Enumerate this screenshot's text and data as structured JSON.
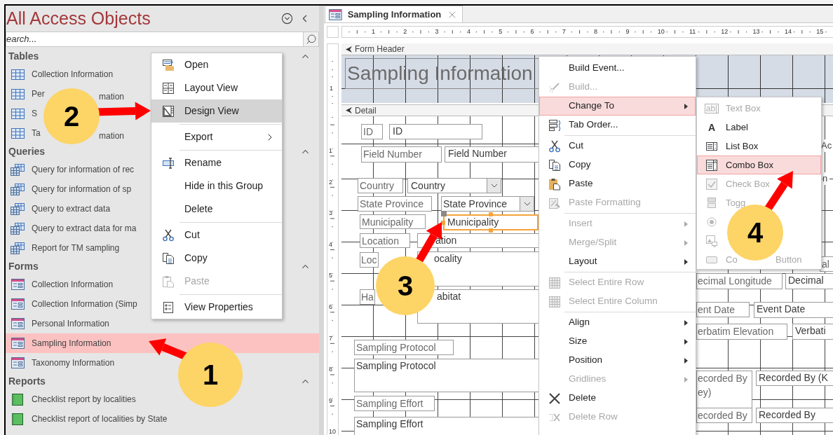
{
  "nav": {
    "title": "All Access Objects",
    "search": {
      "placeholder": "earch..."
    },
    "sections": [
      {
        "title": "Tables",
        "kind": "table",
        "items": [
          {
            "label": "Collection Information",
            "selected": false
          },
          {
            "label": "Per",
            "label_end": "mation",
            "selected": false
          },
          {
            "label": "S",
            "selected": false
          },
          {
            "label": "Ta",
            "label_end": "mation",
            "selected": false
          }
        ]
      },
      {
        "title": "Queries",
        "kind": "query",
        "items": [
          {
            "label": "Query for information of rec",
            "selected": false
          },
          {
            "label": "Query for information of sp",
            "selected": false
          },
          {
            "label": "Query to extract data",
            "selected": false
          },
          {
            "label": "Query to extract data for ma",
            "selected": false
          },
          {
            "label": "Report for TM sampling",
            "selected": false
          }
        ]
      },
      {
        "title": "Forms",
        "kind": "form",
        "items": [
          {
            "label": "Collection Information",
            "selected": false
          },
          {
            "label": "Collection Information (Simp",
            "selected": false
          },
          {
            "label": "Personal Information",
            "selected": false
          },
          {
            "label": "Sampling Information",
            "selected": true
          },
          {
            "label": "Taxonomy Information",
            "selected": false
          }
        ]
      },
      {
        "title": "Reports",
        "kind": "report",
        "items": [
          {
            "label": "Checklist report by localities",
            "selected": false
          },
          {
            "label": "Checklist report of localities by State",
            "selected": false
          }
        ]
      }
    ]
  },
  "nav_menu": {
    "items": [
      {
        "kind": "item",
        "label": "Open",
        "selected": false,
        "disabled": false,
        "submenu": false
      },
      {
        "kind": "item",
        "label": "Layout View",
        "selected": false,
        "disabled": false,
        "submenu": false
      },
      {
        "kind": "item",
        "label": "Design View",
        "selected": true,
        "disabled": false,
        "submenu": false
      },
      {
        "kind": "separator"
      },
      {
        "kind": "item",
        "label": "Export",
        "selected": false,
        "disabled": false,
        "submenu": true
      },
      {
        "kind": "separator"
      },
      {
        "kind": "item",
        "label": "Rename",
        "selected": false,
        "disabled": false,
        "submenu": false
      },
      {
        "kind": "item",
        "label": "Hide in this Group",
        "selected": false,
        "disabled": false,
        "submenu": false
      },
      {
        "kind": "item",
        "label": "Delete",
        "selected": false,
        "disabled": false,
        "submenu": false
      },
      {
        "kind": "separator"
      },
      {
        "kind": "item",
        "label": "Cut",
        "selected": false,
        "disabled": false,
        "submenu": false
      },
      {
        "kind": "item",
        "label": "Copy",
        "selected": false,
        "disabled": false,
        "submenu": false
      },
      {
        "kind": "item",
        "label": "Paste",
        "selected": false,
        "disabled": true,
        "submenu": false
      },
      {
        "kind": "separator"
      },
      {
        "kind": "item",
        "label": "View Properties",
        "selected": false,
        "disabled": false,
        "submenu": false
      }
    ]
  },
  "document": {
    "tab": {
      "title": "Sampling Information"
    },
    "ruler_marks": [
      "1",
      "2",
      "3",
      "4",
      "5",
      "6",
      "7",
      "8",
      "9",
      "10",
      "11",
      "12",
      "13",
      "14",
      "15"
    ],
    "vertical_ruler": {
      "header_marks": [
        "1"
      ],
      "detail_marks": [
        "1",
        "2",
        "3",
        "4",
        "5",
        "6",
        "7",
        "8",
        "9",
        "10"
      ]
    },
    "bands": [
      {
        "title": "Form Header"
      },
      {
        "title": "Detail"
      }
    ],
    "header_label": "Sampling Information",
    "controls": [
      {
        "kind": "label",
        "text": "ID",
        "selected": false
      },
      {
        "kind": "textbox",
        "text": "ID",
        "selected": false
      },
      {
        "kind": "label",
        "text": "Field Number",
        "selected": false
      },
      {
        "kind": "textbox",
        "text": "Field Number",
        "selected": false
      },
      {
        "kind": "label",
        "text": "Country",
        "selected": false
      },
      {
        "kind": "combo",
        "text": "Country",
        "selected": false
      },
      {
        "kind": "label",
        "text": "State Province",
        "selected": false
      },
      {
        "kind": "combo",
        "text": "State Province",
        "selected": false
      },
      {
        "kind": "label",
        "text": "Municipality",
        "selected": false
      },
      {
        "kind": "textbox",
        "text": "Municipality",
        "selected": true
      },
      {
        "kind": "label",
        "text": "Location",
        "selected": false
      },
      {
        "kind": "textbox",
        "text": "ation",
        "selected": false
      },
      {
        "kind": "label",
        "text": "Loc",
        "selected": false
      },
      {
        "kind": "textbox",
        "text": "ocality",
        "selected": false
      },
      {
        "kind": "label",
        "text": "Ha",
        "selected": false
      },
      {
        "kind": "textbox",
        "text": "abitat",
        "selected": false
      },
      {
        "kind": "label",
        "text": "Sampling Protocol",
        "selected": false
      },
      {
        "kind": "textbox",
        "text": "Sampling Protocol",
        "selected": false
      },
      {
        "kind": "label",
        "text": "Sampling Effort",
        "selected": false
      },
      {
        "kind": "textbox",
        "text": "Sampling Effort",
        "selected": false
      },
      {
        "kind": "text",
        "text": "Ac",
        "selected": false
      },
      {
        "kind": "text",
        "text": "n",
        "selected": false
      },
      {
        "kind": "label",
        "text": "al",
        "selected": false
      },
      {
        "kind": "label",
        "text": "ecimal Longitude",
        "selected": false
      },
      {
        "kind": "textbox",
        "text": "Decimal",
        "selected": false
      },
      {
        "kind": "label",
        "text": "ent Date",
        "selected": false
      },
      {
        "kind": "textbox",
        "text": "Event Date",
        "selected": false
      },
      {
        "kind": "label",
        "text": "erbatim Elevation",
        "selected": false
      },
      {
        "kind": "textbox",
        "text": "Verbati",
        "selected": false
      },
      {
        "kind": "label",
        "text": "ecorded By\ney)",
        "selected": false
      },
      {
        "kind": "textbox",
        "text": "Recorded By (K",
        "selected": false
      },
      {
        "kind": "label",
        "text": "ecorded By",
        "selected": false
      },
      {
        "kind": "textbox",
        "text": "Recorded By",
        "selected": false
      }
    ]
  },
  "design_menu": {
    "items": [
      {
        "kind": "item",
        "label": "Build Event...",
        "selected": false,
        "disabled": false,
        "submenu": false
      },
      {
        "kind": "item",
        "label": "Build...",
        "selected": false,
        "disabled": true,
        "submenu": false
      },
      {
        "kind": "item",
        "label": "Change To",
        "selected": true,
        "disabled": false,
        "submenu": true
      },
      {
        "kind": "item",
        "label": "Tab Order...",
        "selected": false,
        "disabled": false,
        "submenu": false
      },
      {
        "kind": "separator"
      },
      {
        "kind": "item",
        "label": "Cut",
        "selected": false,
        "disabled": false,
        "submenu": false
      },
      {
        "kind": "item",
        "label": "Copy",
        "selected": false,
        "disabled": false,
        "submenu": false
      },
      {
        "kind": "item",
        "label": "Paste",
        "selected": false,
        "disabled": false,
        "submenu": false
      },
      {
        "kind": "item",
        "label": "Paste Formatting",
        "selected": false,
        "disabled": true,
        "submenu": false
      },
      {
        "kind": "separator"
      },
      {
        "kind": "item",
        "label": "Insert",
        "selected": false,
        "disabled": true,
        "submenu": true
      },
      {
        "kind": "item",
        "label": "Merge/Split",
        "selected": false,
        "disabled": true,
        "submenu": true
      },
      {
        "kind": "item",
        "label": "Layout",
        "selected": false,
        "disabled": false,
        "submenu": true
      },
      {
        "kind": "separator"
      },
      {
        "kind": "item",
        "label": "Select Entire Row",
        "selected": false,
        "disabled": true,
        "submenu": false
      },
      {
        "kind": "item",
        "label": "Select Entire Column",
        "selected": false,
        "disabled": true,
        "submenu": false
      },
      {
        "kind": "separator"
      },
      {
        "kind": "item",
        "label": "Align",
        "selected": false,
        "disabled": false,
        "submenu": true
      },
      {
        "kind": "item",
        "label": "Size",
        "selected": false,
        "disabled": false,
        "submenu": true
      },
      {
        "kind": "item",
        "label": "Position",
        "selected": false,
        "disabled": false,
        "submenu": true
      },
      {
        "kind": "item",
        "label": "Gridlines",
        "selected": false,
        "disabled": true,
        "submenu": true
      },
      {
        "kind": "item",
        "label": "Delete",
        "selected": false,
        "disabled": false,
        "submenu": false
      },
      {
        "kind": "item",
        "label": "Delete Row",
        "selected": false,
        "disabled": true,
        "submenu": false
      }
    ]
  },
  "submenu": {
    "items": [
      {
        "kind": "item",
        "glyph": "ab|",
        "label": "Text Box",
        "selected": false,
        "disabled": true,
        "submenu": false
      },
      {
        "kind": "item",
        "glyph": "A",
        "label": "Label",
        "selected": false,
        "disabled": false,
        "submenu": false
      },
      {
        "kind": "item",
        "label": "List Box",
        "selected": false,
        "disabled": false,
        "submenu": false
      },
      {
        "kind": "item",
        "label": "Combo Box",
        "selected": true,
        "disabled": false,
        "submenu": false
      },
      {
        "kind": "item",
        "label": "Check Box",
        "selected": false,
        "disabled": true,
        "submenu": false
      },
      {
        "kind": "item",
        "label": "Togg",
        "selected": false,
        "disabled": true,
        "submenu": false
      },
      {
        "kind": "item",
        "selected": false,
        "disabled": true,
        "submenu": false
      },
      {
        "kind": "item",
        "selected": false,
        "disabled": true,
        "submenu": false
      },
      {
        "kind": "item",
        "label": "Co",
        "label_end": "Button",
        "selected": false,
        "disabled": true,
        "submenu": false
      }
    ]
  },
  "callouts": [
    {
      "number": "1"
    },
    {
      "number": "2"
    },
    {
      "number": "3"
    },
    {
      "number": "4"
    }
  ]
}
